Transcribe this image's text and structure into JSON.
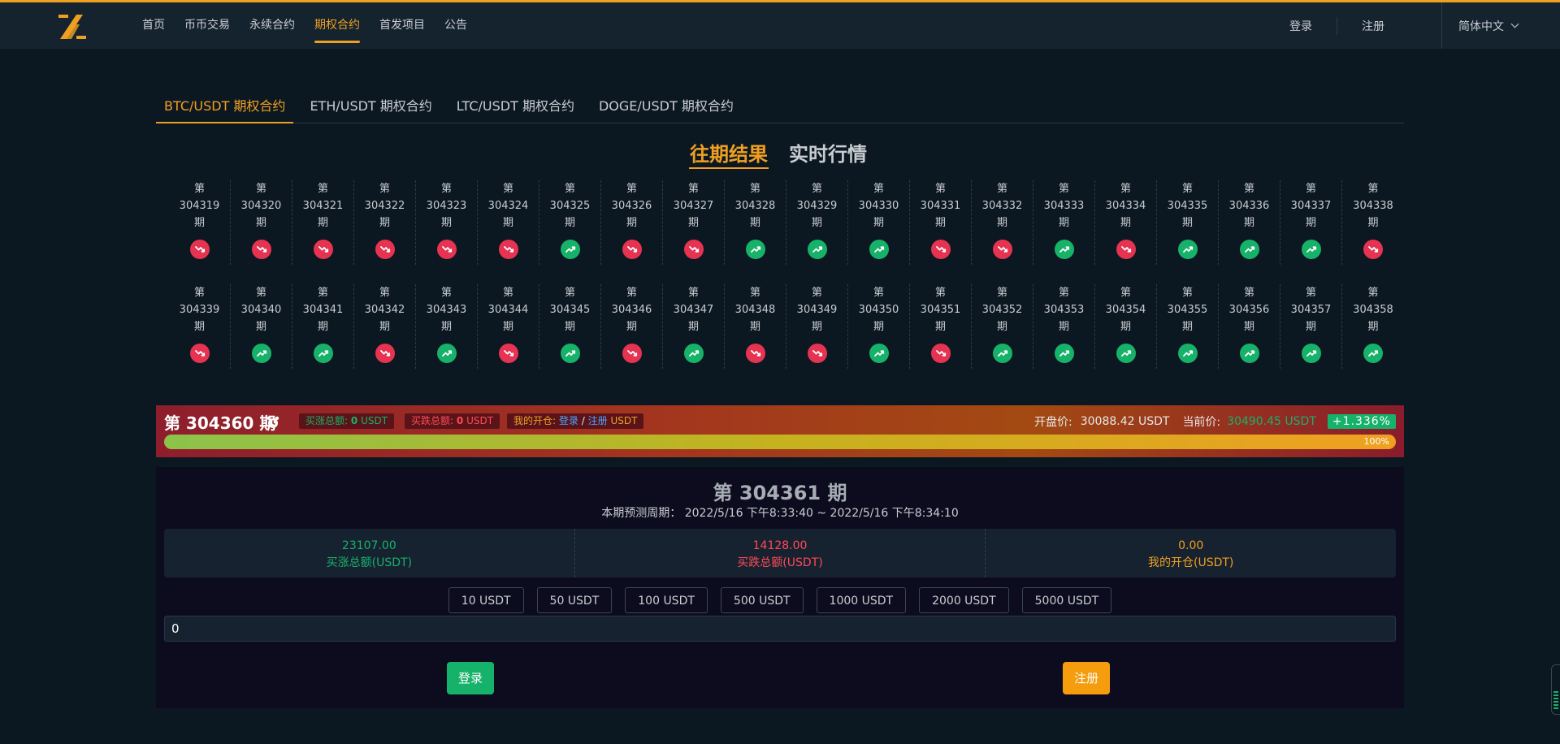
{
  "header": {
    "nav": [
      "首页",
      "币币交易",
      "永续合约",
      "期权合约",
      "首发项目",
      "公告"
    ],
    "active_nav": 3,
    "login": "登录",
    "register": "注册",
    "language": "简体中文"
  },
  "pair_tabs": [
    "BTC/USDT 期权合约",
    "ETH/USDT 期权合约",
    "LTC/USDT 期权合约",
    "DOGE/USDT 期权合约"
  ],
  "active_pair": 0,
  "section_tabs": [
    "往期结果",
    "实时行情"
  ],
  "active_section": 0,
  "period_prefix": "第",
  "period_suffix": "期",
  "history": [
    {
      "id": "304319",
      "dir": "down"
    },
    {
      "id": "304320",
      "dir": "down"
    },
    {
      "id": "304321",
      "dir": "down"
    },
    {
      "id": "304322",
      "dir": "down"
    },
    {
      "id": "304323",
      "dir": "down"
    },
    {
      "id": "304324",
      "dir": "down"
    },
    {
      "id": "304325",
      "dir": "up"
    },
    {
      "id": "304326",
      "dir": "down"
    },
    {
      "id": "304327",
      "dir": "down"
    },
    {
      "id": "304328",
      "dir": "up"
    },
    {
      "id": "304329",
      "dir": "up"
    },
    {
      "id": "304330",
      "dir": "up"
    },
    {
      "id": "304331",
      "dir": "down"
    },
    {
      "id": "304332",
      "dir": "down"
    },
    {
      "id": "304333",
      "dir": "up"
    },
    {
      "id": "304334",
      "dir": "down"
    },
    {
      "id": "304335",
      "dir": "up"
    },
    {
      "id": "304336",
      "dir": "up"
    },
    {
      "id": "304337",
      "dir": "up"
    },
    {
      "id": "304338",
      "dir": "down"
    },
    {
      "id": "304339",
      "dir": "down"
    },
    {
      "id": "304340",
      "dir": "up"
    },
    {
      "id": "304341",
      "dir": "up"
    },
    {
      "id": "304342",
      "dir": "down"
    },
    {
      "id": "304343",
      "dir": "up"
    },
    {
      "id": "304344",
      "dir": "down"
    },
    {
      "id": "304345",
      "dir": "up"
    },
    {
      "id": "304346",
      "dir": "down"
    },
    {
      "id": "304347",
      "dir": "up"
    },
    {
      "id": "304348",
      "dir": "down"
    },
    {
      "id": "304349",
      "dir": "down"
    },
    {
      "id": "304350",
      "dir": "up"
    },
    {
      "id": "304351",
      "dir": "down"
    },
    {
      "id": "304352",
      "dir": "up"
    },
    {
      "id": "304353",
      "dir": "up"
    },
    {
      "id": "304354",
      "dir": "up"
    },
    {
      "id": "304355",
      "dir": "up"
    },
    {
      "id": "304356",
      "dir": "up"
    },
    {
      "id": "304357",
      "dir": "up"
    },
    {
      "id": "304358",
      "dir": "up"
    }
  ],
  "current": {
    "title": "第 304360 期",
    "buy_label": "买涨总额:",
    "buy_value": "0",
    "sell_label": "买跌总额:",
    "sell_value": "0",
    "unit": "USDT",
    "mine_label": "我的开仓:",
    "mine_login": "登录",
    "mine_sep": "/",
    "mine_register": "注册",
    "open_label": "开盘价:",
    "open_value": "30088.42 USDT",
    "now_label": "当前价:",
    "now_value": "30490.45 USDT",
    "change": "+1.336%",
    "progress": 100,
    "progress_text": "100%"
  },
  "next": {
    "title": "第 304361 期",
    "time": "本期预测周期： 2022/5/16 下午8:33:40 ~ 2022/5/16 下午8:34:10",
    "buy_total": "23107.00",
    "buy_total_label": "买涨总额(USDT)",
    "sell_total": "14128.00",
    "sell_total_label": "买跌总额(USDT)",
    "my_total": "0.00",
    "my_total_label": "我的开仓(USDT)",
    "amounts": [
      "10 USDT",
      "50 USDT",
      "100 USDT",
      "500 USDT",
      "1000 USDT",
      "2000 USDT",
      "5000 USDT"
    ],
    "input_value": "0",
    "login_button": "登录",
    "register_button": "注册"
  },
  "colors": {
    "accent": "#f0a020",
    "up": "#17b26a",
    "down": "#e73352"
  }
}
